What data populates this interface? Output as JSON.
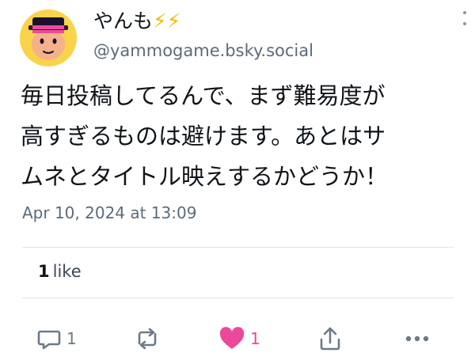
{
  "post": {
    "author": {
      "display_name": "やんも",
      "name_emoji": "⚡⚡",
      "handle": "@yammogame.bsky.social",
      "avatar_icon": "cartoon-face-with-hat-avatar"
    },
    "body_lines": [
      "毎日投稿してるんで、まず難易度が",
      "高すぎるものは避けます。あとはサ",
      "ムネとタイトル映えするかどうか！"
    ],
    "timestamp": "Apr 10, 2024 at 13:09",
    "likes_count": "1",
    "likes_label": "like",
    "actions": {
      "reply_count": "1",
      "like_count": "1"
    },
    "colors": {
      "like_active": "#ec4899",
      "secondary_text": "#5b6b7b",
      "bolt": "#f5b800"
    }
  }
}
